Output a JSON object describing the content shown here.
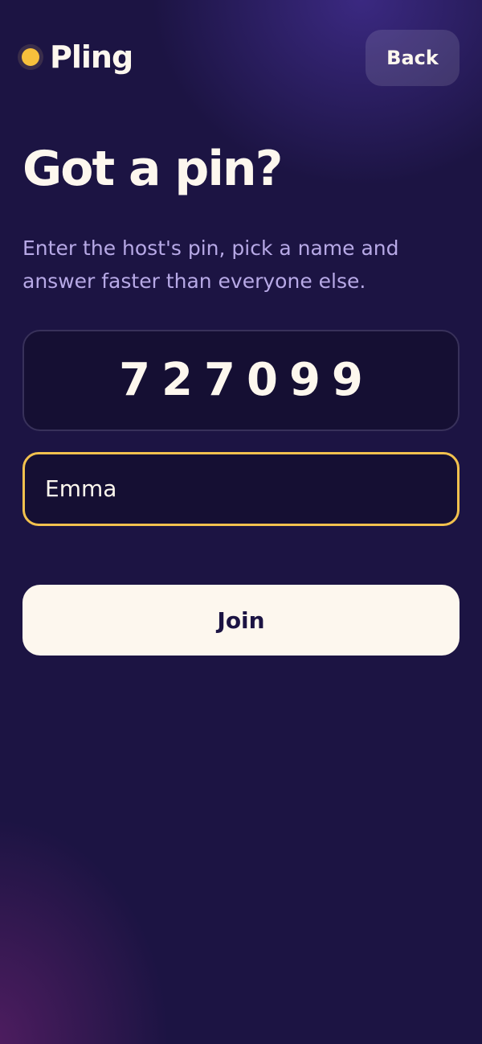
{
  "header": {
    "logo_text": "Pling",
    "back_label": "Back"
  },
  "main": {
    "title": "Got a pin?",
    "subtitle": "Enter the host's pin, pick a name and answer faster than everyone else.",
    "pin_value": "727099",
    "name_value": "Emma",
    "join_label": "Join"
  },
  "colors": {
    "background": "#1c1443",
    "accent": "#f2c14e",
    "text_light": "#fdf7ee",
    "subtitle": "#b7a9e6"
  }
}
